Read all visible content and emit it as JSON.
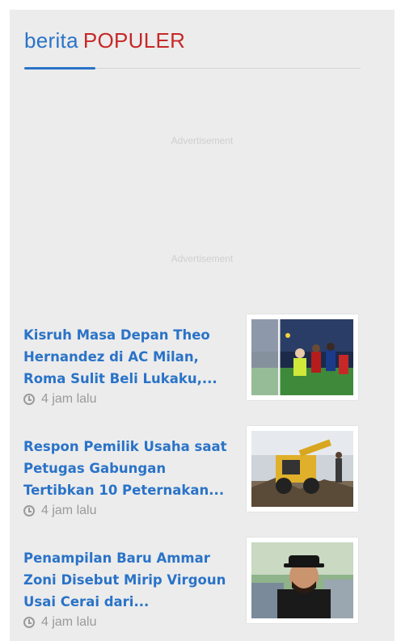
{
  "header": {
    "title_part1": "berita",
    "title_part2": "POPULER"
  },
  "ads": {
    "label1": "Advertisement",
    "label2": "Advertisement"
  },
  "articles": [
    {
      "title": "Kisruh Masa Depan Theo Hernandez di AC Milan, Roma Sulit Beli Lukaku,...",
      "time": "4 jam lalu",
      "image": "football-match-photo"
    },
    {
      "title": "Respon Pemilik Usaha saat Petugas Gabungan Tertibkan 10 Peternakan...",
      "time": "4 jam lalu",
      "image": "excavator-photo"
    },
    {
      "title": "Penampilan Baru Ammar Zoni Disebut Mirip Virgoun Usai Cerai dari...",
      "time": "4 jam lalu",
      "image": "man-in-hat-photo"
    }
  ],
  "colors": {
    "accent": "#2a73c8",
    "highlight": "#c62828",
    "muted": "#9a9a9a"
  }
}
